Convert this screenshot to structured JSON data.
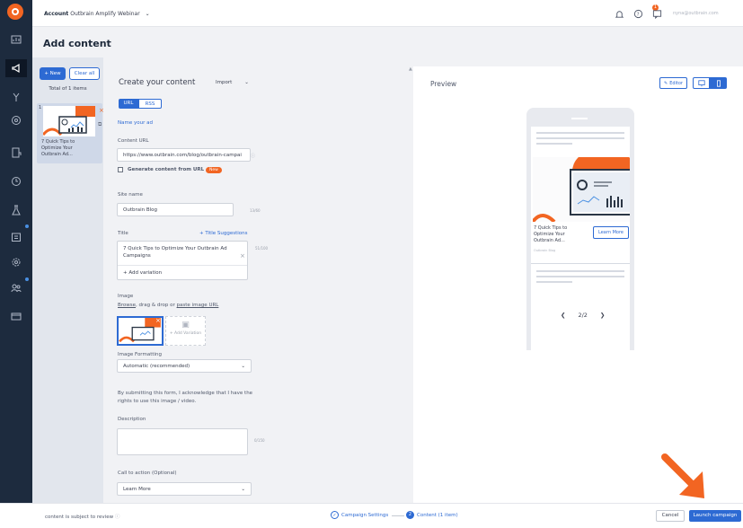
{
  "topbar": {
    "account_label": "Account",
    "account_name": "Outbrain Amplify Webinar",
    "notif_count": "1",
    "user_email": "nyna@outbrain.com"
  },
  "page": {
    "title": "Add content"
  },
  "list": {
    "new_label": "+ New",
    "clear_label": "Clear all",
    "total": "Total of 1 items",
    "item_number": "1",
    "item_title": "7 Quick Tips to Optimize Your Outbrain Ad..."
  },
  "form": {
    "create_title": "Create your content",
    "import_label": "Import",
    "tab_url": "URL",
    "tab_rss": "RSS",
    "name_ad": "Name your ad",
    "content_url_label": "Content URL",
    "content_url_value": "https://www.outbrain.com/blog/outbrain-campai",
    "generate_label": "Generate content from URL",
    "new_pill": "New",
    "site_name_label": "Site name",
    "site_name_value": "Outbrain Blog",
    "site_counter": "13/60",
    "title_label": "Title",
    "title_suggestions": "+ Title Suggestions",
    "title_value": "7 Quick Tips to Optimize Your Outbrain Ad Campaigns",
    "title_counter": "51/100",
    "add_variation": "+ Add variation",
    "image_label": "Image",
    "image_browse": "Browse",
    "image_mid": ", drag & drop or ",
    "image_paste": "paste image URL",
    "add_variation_image": "+ Add Variation",
    "image_formatting_label": "Image Formatting",
    "image_formatting_value": "Automatic (recommended)",
    "rights_text": "By submitting this form, I acknowledge that I have the rights to use this image / video.",
    "description_label": "Description",
    "description_counter": "0/150",
    "cta_label": "Call to action (Optional)",
    "cta_value": "Learn More"
  },
  "preview": {
    "title": "Preview",
    "editor_label": "Editor",
    "card_title": "7 Quick Tips to Optimize Your Outbrain Ad...",
    "card_site": "Outbrain Blog",
    "cta": "Learn More",
    "pager": "2/2"
  },
  "footer": {
    "review_text": "content is subject to review",
    "step1": "Campaign Settings",
    "step2_num": "2",
    "step2": "Content (1 item)",
    "cancel": "Cancel",
    "launch": "Launch campaign"
  },
  "colors": {
    "accent": "#2d6ad3",
    "brand": "#f26522",
    "sidebar": "#1d2b3e"
  }
}
